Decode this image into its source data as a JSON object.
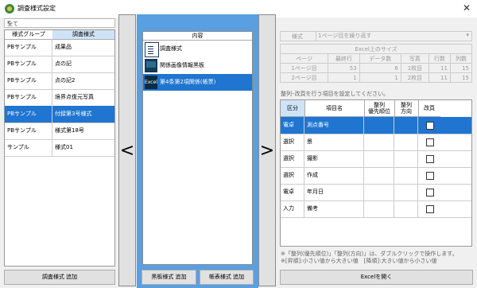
{
  "window": {
    "title": "調査様式設定",
    "close": "✕"
  },
  "left": {
    "filter": "全て",
    "headers": [
      "様式グループ",
      "調査様式"
    ],
    "rows": [
      [
        "PBサンプル",
        "成果品"
      ],
      [
        "PBサンプル",
        "点の記"
      ],
      [
        "PBサンプル",
        "点の記2"
      ],
      [
        "PBサンプル",
        "境界点復元写真"
      ],
      [
        "PBサンプル",
        "付録第3号様式"
      ],
      [
        "PBサンプル",
        "様式第18号"
      ],
      [
        "サンプル",
        "様式01"
      ]
    ],
    "selected_row": 4,
    "add_button": "調査様式 追加"
  },
  "arrows": {
    "left": "<",
    "right": ">"
  },
  "middle": {
    "header": "内容",
    "items": [
      {
        "icon": "document-icon",
        "label": "調査様式"
      },
      {
        "icon": "blackboard-icon",
        "label": "関係画像情報黒板"
      },
      {
        "icon": "excel-icon",
        "icon_text": "Excel",
        "label": "第4条第2項関係(帳票)"
      }
    ],
    "selected_item": 2,
    "add_board_button": "黒板様式 追加",
    "add_form_button": "帳表様式 追加"
  },
  "right": {
    "style_label": "様式",
    "style_value": "1ページ目を繰り返す",
    "size_title": "Excel上のサイズ",
    "size_headers": [
      "ページ",
      "最終行",
      "データ数",
      "写真",
      "行数",
      "列数"
    ],
    "size_rows": [
      [
        "1ページ目",
        "53",
        "6",
        "1枚目",
        "11",
        "15"
      ],
      [
        "2ページ目",
        "1",
        "1",
        "2枚目",
        "11",
        "15"
      ]
    ],
    "note_top": "整列･改頁を行う項目を設定してください。",
    "grid_headers": [
      "区分",
      "項目名",
      "整列\n優先順位",
      "整列\n方向",
      "改頁"
    ],
    "grid_rows": [
      [
        "電卓",
        "測点番号"
      ],
      [
        "選択",
        "景"
      ],
      [
        "選択",
        "撮影"
      ],
      [
        "選択",
        "作成"
      ],
      [
        "電卓",
        "年月日"
      ],
      [
        "入力",
        "備考"
      ]
    ],
    "selected_row": 0,
    "note1": "※「整列(優先順位)」「整列(方向)」は、ダブルクリックで操作します。",
    "note2": "※[昇順]:小さい値から大きい値　[降順]:大きい値から小さい値",
    "excel_button": "Excelを開く"
  }
}
